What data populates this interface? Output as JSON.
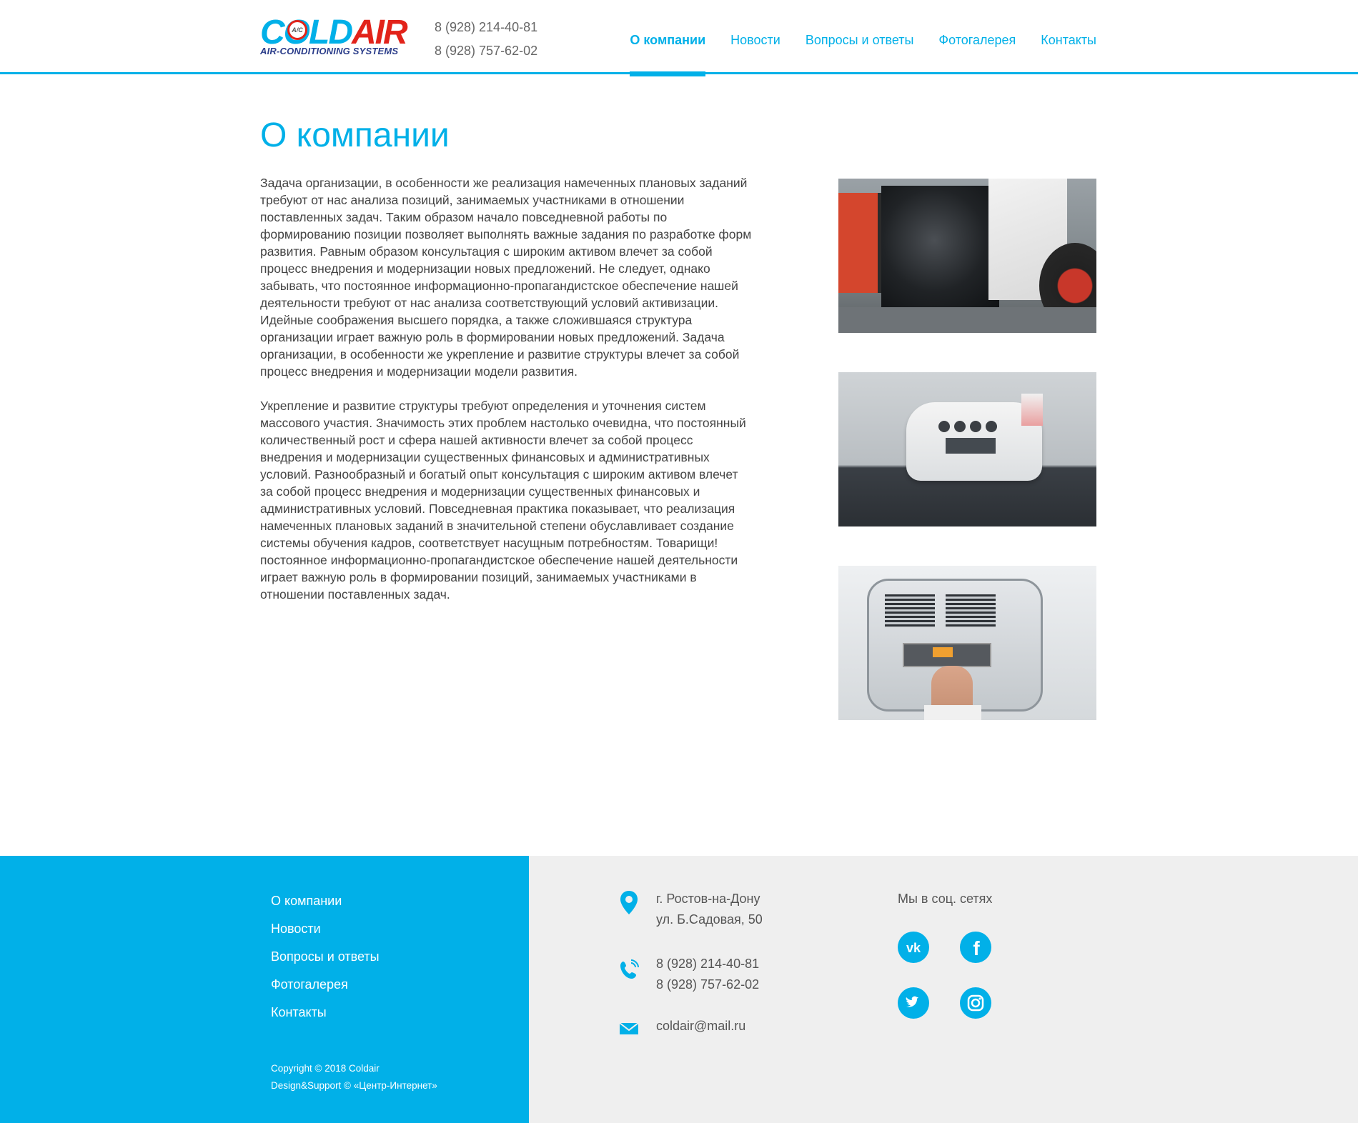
{
  "brand": {
    "logo_word_cold": "COLD",
    "logo_word_air": "AIR",
    "logo_badge": "A/C",
    "logo_tagline": "AIR-CONDITIONING SYSTEMS",
    "accent_color": "#01b0e8",
    "logo_red": "#e2231a"
  },
  "header": {
    "phones": [
      "8 (928) 214-40-81",
      "8 (928) 757-62-02"
    ],
    "nav": [
      {
        "label": "О компании",
        "active": true
      },
      {
        "label": "Новости",
        "active": false
      },
      {
        "label": "Вопросы и ответы",
        "active": false
      },
      {
        "label": "Фотогалерея",
        "active": false
      },
      {
        "label": "Контакты",
        "active": false
      }
    ]
  },
  "main": {
    "title": "О компании",
    "paragraphs": [
      "Задача организации, в особенности же реализация намеченных плановых заданий требуют от нас анализа позиций, занимаемых участниками в отношении поставленных задач. Таким образом начало повседневной работы по формированию позиции позволяет выполнять важные задания по разработке форм развития. Равным образом консультация с широким активом влечет за собой процесс внедрения и модернизации новых предложений. Не следует, однако забывать, что постоянное информационно-пропагандистское обеспечение нашей деятельности требуют от нас анализа соответствующий условий активизации. Идейные соображения высшего порядка, а также сложившаяся структура организации играет важную роль в формировании новых предложений. Задача организации, в особенности же укрепление и развитие структуры влечет за собой процесс внедрения и модернизации модели развития.",
      "Укрепление и развитие структуры требуют определения и уточнения систем массового участия. Значимость этих проблем настолько очевидна, что постоянный количественный рост и сфера нашей активности влечет за собой процесс внедрения и модернизации существенных финансовых и административных условий. Разнообразный и богатый опыт консультация с широким активом влечет за собой процесс внедрения и модернизации существенных финансовых и административных условий. Повседневная практика показывает, что реализация намеченных плановых заданий в значительной степени обуславливает создание системы обучения кадров, соответствует насущным потребностям. Товарищи! постоянное информационно-пропагандистское обеспечение нашей деятельности играет важную роль в формировании позиций, занимаемых участниками в отношении поставленных задач."
    ],
    "gallery": [
      "engine-bay-photo",
      "roof-air-conditioner-photo",
      "control-panel-photo"
    ]
  },
  "footer": {
    "nav": [
      "О компании",
      "Новости",
      "Вопросы и ответы",
      "Фотогалерея",
      "Контакты"
    ],
    "copyright": "Copyright © 2018 Coldair",
    "design": "Design&Support © «Центр-Интернет»",
    "address_line1": "г. Ростов-на-Дону",
    "address_line2": "ул. Б.Садовая, 50",
    "phone1": "8 (928) 214-40-81",
    "phone2": "8 (928) 757-62-02",
    "email": "coldair@mail.ru",
    "social_title": "Мы в соц. сетях",
    "social": [
      "vk-icon",
      "facebook-icon",
      "twitter-icon",
      "instagram-icon"
    ]
  }
}
